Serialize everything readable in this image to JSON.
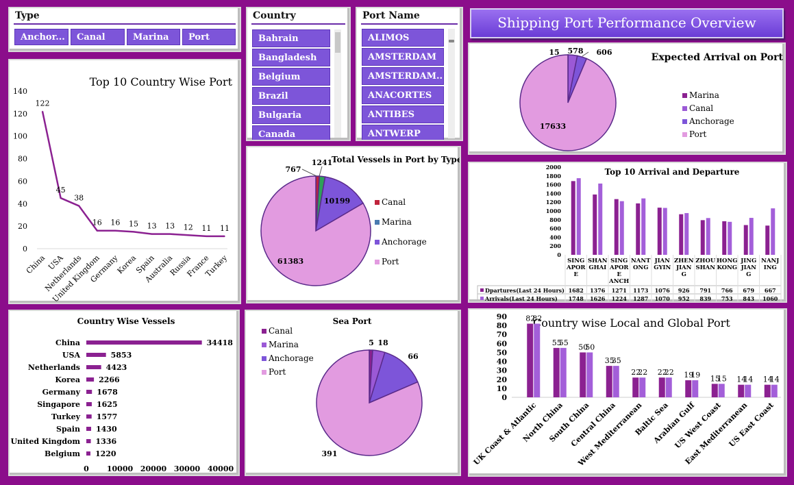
{
  "dashboard_title": "Shipping Port Performance Overview",
  "slicers": {
    "type": {
      "title": "Type",
      "items": [
        "Anchor...",
        "Canal",
        "Marina",
        "Port"
      ]
    },
    "country": {
      "title": "Country",
      "items": [
        "Bahrain",
        "Bangladesh",
        "Belgium",
        "Brazil",
        "Bulgaria",
        "Canada"
      ]
    },
    "port_name": {
      "title": "Port Name",
      "items": [
        "ALIMOS",
        "AMSTERDAM",
        "AMSTERDAM...",
        "ANACORTES",
        "ANTIBES",
        "ANTWERP"
      ]
    }
  },
  "colors": {
    "background": "#8b0d8b",
    "accent": "#7d55d9",
    "line": "#8b2191",
    "port": "#e29be0",
    "marina": "#8b2191",
    "canal": "#9b59d6",
    "anchorage": "#7d55d9"
  },
  "chart_data": [
    {
      "id": "top10_country",
      "type": "line",
      "title": "Top 10 Country Wise Port",
      "categories": [
        "China",
        "USA",
        "Netherlands",
        "United Kingdom",
        "Germany",
        "Korea",
        "Spain",
        "Australia",
        "Russia",
        "France",
        "Turkey"
      ],
      "values": [
        122,
        45,
        38,
        16,
        16,
        15,
        13,
        13,
        12,
        11,
        11
      ],
      "ylim": [
        0,
        140
      ],
      "yticks": [
        0,
        20,
        40,
        60,
        80,
        100,
        120,
        140
      ]
    },
    {
      "id": "vessels_by_type",
      "type": "pie",
      "title": "Total Vessels in Port by Type",
      "labels": [
        "Canal",
        "Marina",
        "Anchorage",
        "Port"
      ],
      "values": [
        767,
        1241,
        10199,
        61383
      ],
      "colors": [
        "#c0243c",
        "#2ea05a",
        "#7d55d9",
        "#e29be0"
      ],
      "legend": [
        "Canal",
        "Marina",
        "Anchorage",
        "Port"
      ],
      "legend_colors": [
        "#c0243c",
        "#4a7bb0",
        "#7d55d9",
        "#e29be0"
      ],
      "legend_position": "right"
    },
    {
      "id": "expected_arrival",
      "type": "pie",
      "title": "Expected Arrival on Port",
      "labels": [
        "Marina",
        "Canal",
        "Anchorage",
        "Port"
      ],
      "values": [
        15,
        578,
        606,
        17633
      ],
      "colors": [
        "#8b2191",
        "#9b59d6",
        "#7d55d9",
        "#e29be0"
      ],
      "legend_position": "right"
    },
    {
      "id": "arrival_departure",
      "type": "bar",
      "title": "Top 10 Arrival and Departure",
      "categories": [
        "SINGAPORE",
        "SHANGHAI",
        "SINGAPORE ANCH",
        "NANTONG",
        "JIANGYIN",
        "ZHENJIANG",
        "ZHOUSHAN",
        "HONG KONG",
        "JINGJIANG",
        "NANJING"
      ],
      "category_lines": [
        [
          "SING",
          "APOR",
          "E"
        ],
        [
          "SHAN",
          "GHAI"
        ],
        [
          "SING",
          "APOR",
          "E",
          "ANCH"
        ],
        [
          "NANT",
          "ONG"
        ],
        [
          "JIAN",
          "GYIN"
        ],
        [
          "ZHEN",
          "JIAN",
          "G"
        ],
        [
          "ZHOU",
          "SHAN"
        ],
        [
          "HONG",
          "KONG"
        ],
        [
          "JING",
          "JIAN",
          "G"
        ],
        [
          "NANJ",
          "ING"
        ]
      ],
      "series": [
        {
          "name": "Dpartures(Last 24 Hours)",
          "values": [
            1682,
            1376,
            1271,
            1173,
            1076,
            926,
            791,
            766,
            679,
            667
          ]
        },
        {
          "name": "Arrivals(Last 24 Hours)",
          "values": [
            1748,
            1626,
            1224,
            1287,
            1070,
            952,
            839,
            753,
            843,
            1060
          ]
        }
      ],
      "ylim": [
        0,
        2000
      ],
      "yticks": [
        0,
        200,
        400,
        600,
        800,
        1000,
        1200,
        1400,
        1600,
        1800,
        2000
      ]
    },
    {
      "id": "country_vessels",
      "type": "bar",
      "orientation": "horizontal",
      "title": "Country Wise Vessels",
      "categories": [
        "China",
        "USA",
        "Netherlands",
        "Korea",
        "Germany",
        "Singapore",
        "Turkey",
        "Spain",
        "United Kingdom",
        "Belgium"
      ],
      "values": [
        34418,
        5853,
        4423,
        2266,
        1678,
        1625,
        1577,
        1430,
        1336,
        1220
      ],
      "xlim": [
        0,
        40000
      ],
      "xticks": [
        0,
        10000,
        20000,
        30000,
        40000
      ]
    },
    {
      "id": "sea_port",
      "type": "pie",
      "title": "Sea Port",
      "labels": [
        "Canal",
        "Marina",
        "Anchorage",
        "Port"
      ],
      "values": [
        5,
        18,
        66,
        391
      ],
      "colors": [
        "#8b2191",
        "#9b59d6",
        "#7d55d9",
        "#e29be0"
      ],
      "legend_position": "top-left"
    },
    {
      "id": "local_global",
      "type": "bar",
      "title": "Country wise Local and Global Port",
      "categories": [
        "UK Coast & Atlantic",
        "North China",
        "South China",
        "Central China",
        "West Mediterranean",
        "Baltic Sea",
        "Arabian Gulf",
        "US West Coast",
        "East Mediterranean",
        "US East Coast"
      ],
      "series": [
        {
          "values": [
            82,
            55,
            50,
            35,
            22,
            22,
            19,
            15,
            14,
            14
          ]
        },
        {
          "values": [
            82,
            55,
            50,
            35,
            22,
            22,
            19,
            15,
            14,
            14
          ]
        }
      ],
      "ylim": [
        0,
        90
      ],
      "yticks": [
        0,
        10,
        20,
        30,
        40,
        50,
        60,
        70,
        80,
        90
      ]
    }
  ]
}
